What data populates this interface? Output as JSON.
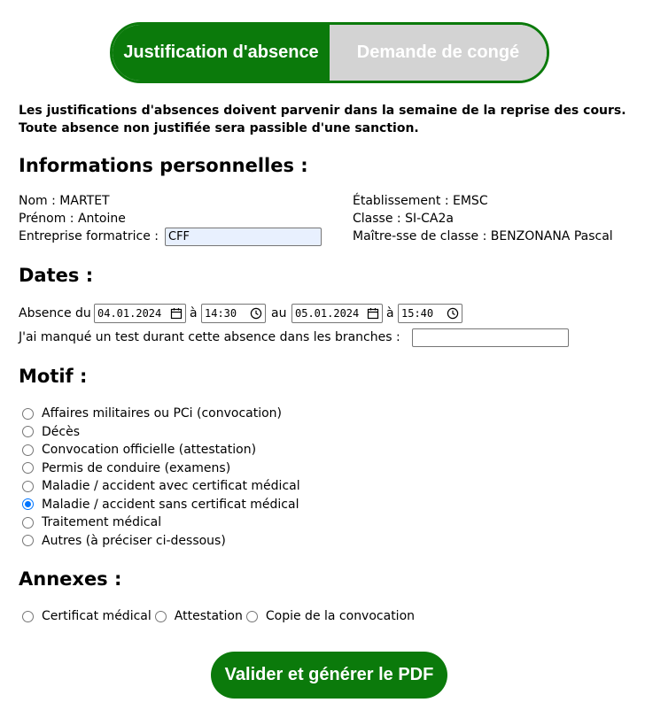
{
  "toggle": {
    "tab_justification": "Justification d'absence",
    "tab_conge": "Demande de congé",
    "active_color": "#0b7a0b",
    "inactive_color": "#d3d3d3"
  },
  "notice": {
    "line1": "Les justifications d'absences doivent parvenir dans la semaine de la reprise des cours.",
    "line2": "Toute absence non justifiée sera passible d'une sanction."
  },
  "personal": {
    "heading": "Informations personnelles :",
    "nom": "Nom : MARTET",
    "prenom": "Prénom : Antoine",
    "entreprise_label": "Entreprise formatrice :",
    "entreprise_value": "CFF",
    "etablissement": "Établissement : EMSC",
    "classe": "Classe : SI-CA2a",
    "maitre": "Maître-sse de classe : BENZONANA Pascal"
  },
  "dates": {
    "heading": "Dates :",
    "absence_label": "Absence du",
    "start_date": "04.01.2024",
    "a1": "à",
    "start_time": "14:30",
    "au": "au",
    "end_date": "05.01.2024",
    "a2": "à",
    "end_time": "15:40",
    "test_label": "J'ai manqué un test durant cette absence dans les branches :",
    "test_value": ""
  },
  "motif": {
    "heading": "Motif :",
    "options": [
      {
        "label": "Affaires militaires ou PCi (convocation)",
        "checked": false
      },
      {
        "label": "Décès",
        "checked": false
      },
      {
        "label": "Convocation officielle (attestation)",
        "checked": false
      },
      {
        "label": "Permis de conduire (examens)",
        "checked": false
      },
      {
        "label": "Maladie / accident avec certificat médical",
        "checked": false
      },
      {
        "label": "Maladie / accident sans certificat médical",
        "checked": true
      },
      {
        "label": "Traitement médical",
        "checked": false
      },
      {
        "label": "Autres (à préciser ci-dessous)",
        "checked": false
      }
    ]
  },
  "annexes": {
    "heading": "Annexes :",
    "options": [
      {
        "label": "Certificat médical",
        "checked": false
      },
      {
        "label": "Attestation",
        "checked": false
      },
      {
        "label": "Copie de la convocation",
        "checked": false
      }
    ]
  },
  "submit_label": "Valider et générer le PDF",
  "icons": {
    "date": "calendar-icon",
    "time": "clock-icon"
  }
}
